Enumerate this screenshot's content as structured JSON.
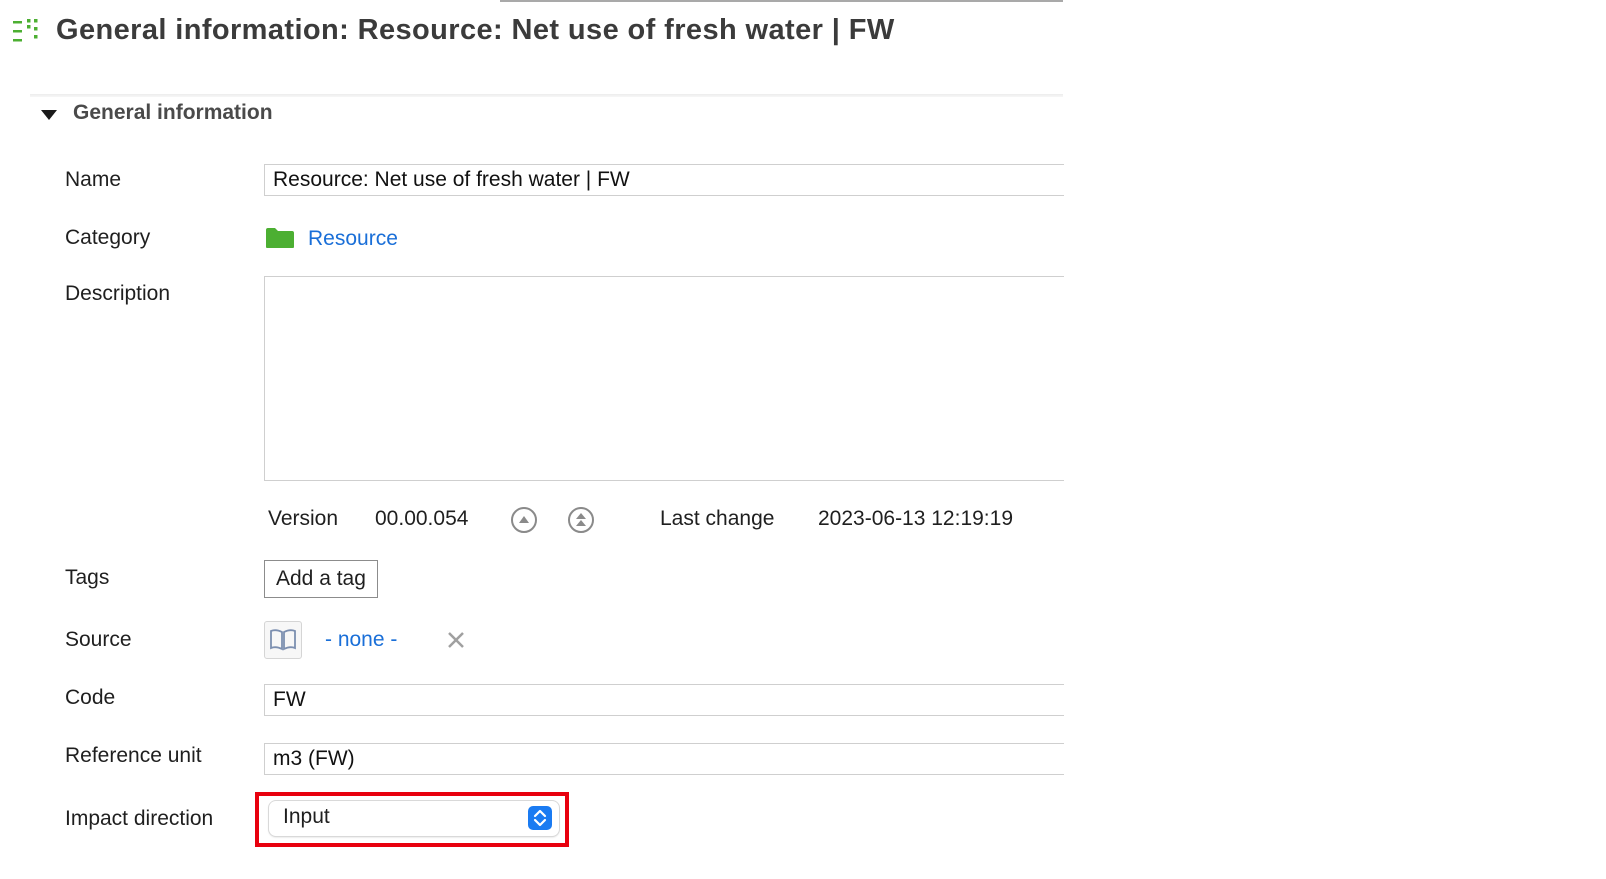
{
  "header": {
    "title": "General information: Resource: Net use of fresh water | FW",
    "icon": "outline-list-icon"
  },
  "section": {
    "title": "General information",
    "toggle_icon": "triangle-down-icon"
  },
  "fields": {
    "name": {
      "label": "Name",
      "value": "Resource: Net use of fresh water | FW"
    },
    "category": {
      "label": "Category",
      "value": "Resource",
      "icon": "folder-icon"
    },
    "description": {
      "label": "Description",
      "value": ""
    },
    "version": {
      "label": "Version",
      "value": "00.00.054",
      "last_change_label": "Last change",
      "last_change_value": "2023-06-13 12:19:19"
    },
    "tags": {
      "label": "Tags",
      "button": "Add a tag"
    },
    "source": {
      "label": "Source",
      "value": "- none -",
      "icon": "book-icon",
      "clear_icon": "close-icon"
    },
    "code": {
      "label": "Code",
      "value": "FW"
    },
    "reference_unit": {
      "label": "Reference unit",
      "value": "m3 (FW)"
    },
    "impact_direction": {
      "label": "Impact direction",
      "value": "Input"
    }
  },
  "colors": {
    "link": "#1a6fd8",
    "folder": "#4caf32",
    "highlight": "#e8000e",
    "select_accent": "#1a7bf2"
  }
}
